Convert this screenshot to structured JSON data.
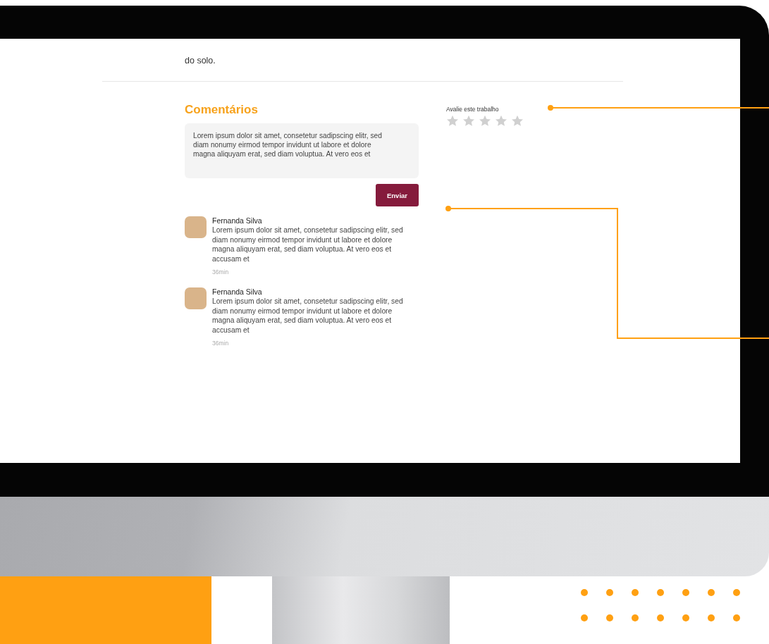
{
  "article": {
    "closing_text": "do solo."
  },
  "comments_section": {
    "title": "Comentários",
    "input": {
      "value": "Lorem ipsum dolor sit amet, consetetur sadipscing elitr, sed diam nonumy eirmod tempor invidunt ut labore et dolore magna aliquyam erat, sed diam voluptua. At vero eos et"
    },
    "submit_button": "Enviar",
    "comments": [
      {
        "author": "Fernanda Silva",
        "text": "Lorem ipsum dolor sit amet, consetetur sadipscing elitr, sed diam nonumy eirmod tempor invidunt ut labore et dolore magna aliquyam erat, sed diam voluptua. At vero eos et accusam et",
        "time": "36min"
      },
      {
        "author": "Fernanda Silva",
        "text": "Lorem ipsum dolor sit amet, consetetur sadipscing elitr, sed diam nonumy eirmod tempor invidunt ut labore et dolore magna aliquyam erat, sed diam voluptua. At vero eos et accusam et",
        "time": "36min"
      }
    ]
  },
  "rating": {
    "label": "Avalie este trabalho",
    "stars": 0
  }
}
